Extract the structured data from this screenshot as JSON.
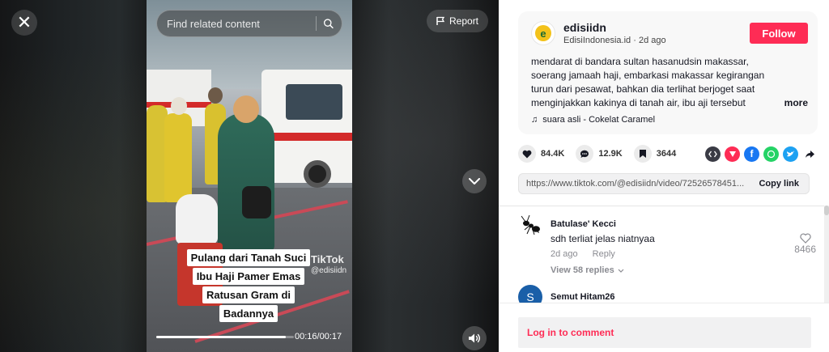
{
  "video": {
    "search_placeholder": "Find related content",
    "report_label": "Report",
    "caption_lines": [
      "Pulang dari Tanah Suci",
      "Ibu Haji Pamer Emas",
      "Ratusan Gram di",
      "Badannya"
    ],
    "watermark_brand": "TikTok",
    "watermark_handle": "@edisiidn",
    "timecode": "00:16/00:17",
    "progress_fraction": 0.94,
    "icons": {
      "close": "close-icon",
      "search": "search-icon",
      "report": "flag-icon",
      "next": "chevron-down-icon",
      "volume": "volume-icon"
    }
  },
  "post": {
    "author_name": "edisiidn",
    "author_display": "EdisiIndonesia.id",
    "date": "2d ago",
    "follow_label": "Follow",
    "description": "mendarat di bandara sultan hasanudsin makassar, soerang jamaah haji, embarkasi makassar kegirangan turun dari pesawat, bahkan dia terlihat berjoget saat menginjakkan kakinya di tanah air, ibu aji tersebut diketahui berjoget...",
    "more_label": "more",
    "music": "suara asli - Cokelat Caramel",
    "avatar_letter": "e"
  },
  "actions": {
    "likes": "84.4K",
    "comments": "12.9K",
    "saves": "3644"
  },
  "link": {
    "url": "https://www.tiktok.com/@edisiidn/video/72526578451...",
    "copy_label": "Copy link"
  },
  "comments": [
    {
      "user": "Batulase' Kecci",
      "text": "sdh terliat jelas niatnyaa",
      "time": "2d ago",
      "reply_label": "Reply",
      "likes": "8466",
      "view_replies": "View 58 replies"
    },
    {
      "user": "Semut Hitam26",
      "avatar_letter": "S"
    }
  ],
  "login": {
    "label": "Log in to comment"
  },
  "colors": {
    "accent": "#fe2c55",
    "facebook": "#1877f2",
    "whatsapp": "#25d366",
    "twitter": "#1da1f2",
    "embed": "#161823",
    "repost": "#fe2c55",
    "semut_avatar": "#1a5fa8"
  }
}
